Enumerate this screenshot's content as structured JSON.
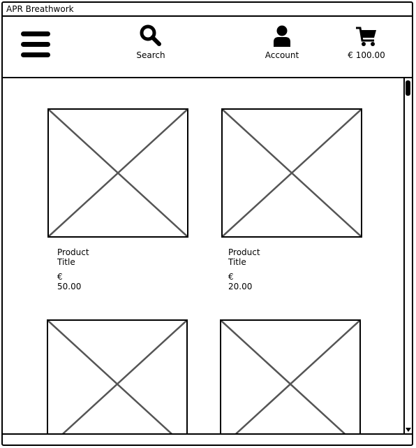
{
  "window": {
    "title": "APR Breathwork"
  },
  "header": {
    "menu_icon": "hamburger-menu-icon",
    "search": {
      "icon": "search-icon",
      "label": "Search"
    },
    "account": {
      "icon": "user-icon",
      "label": "Account"
    },
    "cart": {
      "icon": "cart-icon",
      "label": "€ 100.00"
    }
  },
  "products": [
    {
      "title": "Product Title",
      "price": "€ 50.00"
    },
    {
      "title": "Product Title",
      "price": "€ 20.00"
    },
    {
      "title": "",
      "price": ""
    },
    {
      "title": "",
      "price": ""
    }
  ]
}
